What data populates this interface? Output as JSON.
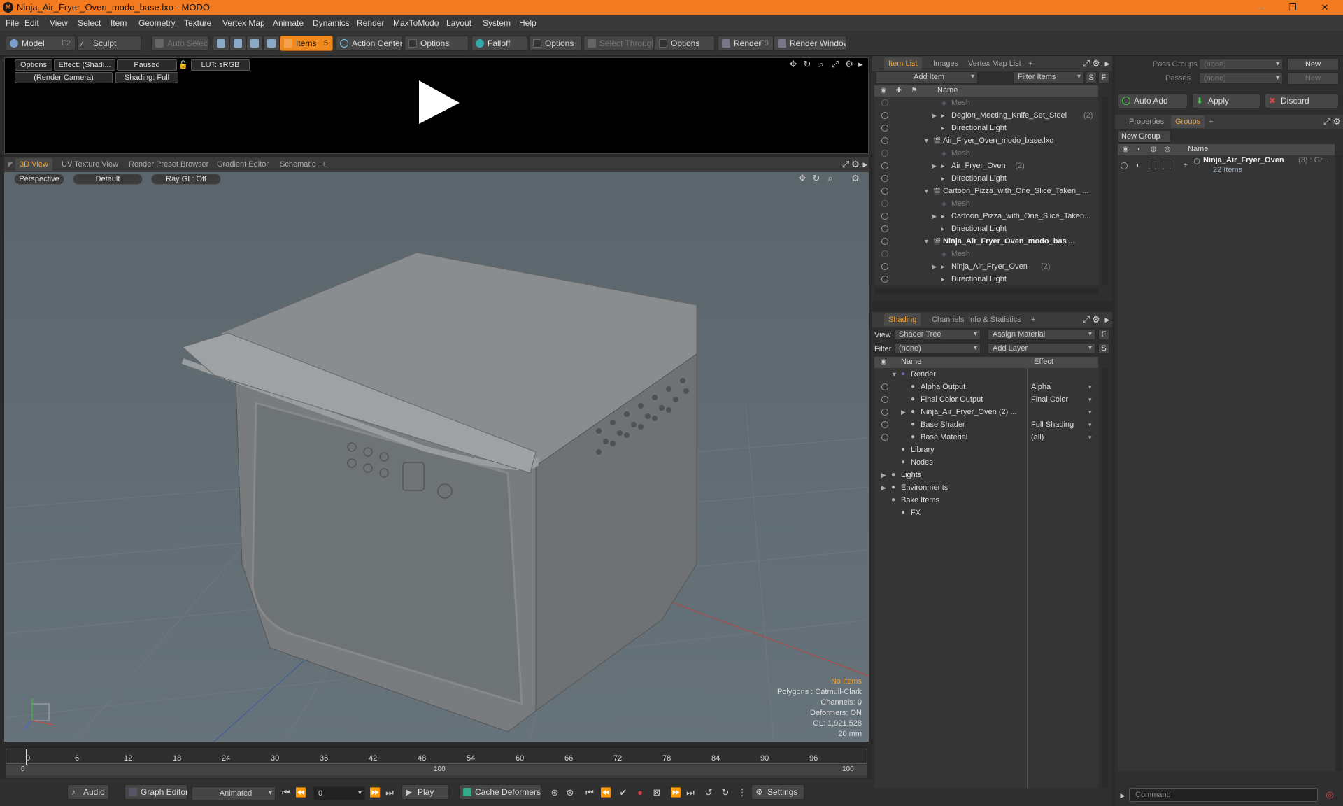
{
  "window": {
    "title": "Ninja_Air_Fryer_Oven_modo_base.lxo - MODO",
    "minimize": "–",
    "restore": "❐",
    "close": "✕"
  },
  "menu": [
    "File",
    "Edit",
    "View",
    "Select",
    "Item",
    "Geometry",
    "Texture",
    "Vertex Map",
    "Animate",
    "Dynamics",
    "Render",
    "MaxToModo",
    "Layout",
    "System",
    "Help"
  ],
  "toolbar": {
    "model": "Model",
    "model_key": "F2",
    "sculpt": "Sculpt",
    "auto_select": "Auto Select",
    "items": "Items",
    "items_key": "5",
    "action_center": "Action Center",
    "options1": "Options",
    "falloff": "Falloff",
    "options2": "Options",
    "select_through": "Select Through",
    "options3": "Options",
    "render": "Render",
    "render_key": "F9",
    "render_window": "Render Window"
  },
  "preview": {
    "options": "Options",
    "effect": "Effect: (Shadi...",
    "paused": "Paused",
    "lut": "LUT: sRGB",
    "camera": "(Render Camera)",
    "shading": "Shading: Full"
  },
  "viewport_tabs": [
    "3D View",
    "UV Texture View",
    "Render Preset Browser",
    "Gradient Editor",
    "Schematic",
    "+"
  ],
  "viewport": {
    "perspective": "Perspective",
    "default": "Default",
    "raygl": "Ray GL: Off"
  },
  "viewport_status": {
    "no_items": "No Items",
    "polygons": "Polygons : Catmull-Clark",
    "channels": "Channels: 0",
    "deformers": "Deformers: ON",
    "gl": "GL: 1,921,528",
    "scale": "20 mm"
  },
  "timeline": {
    "ticks": [
      "0",
      "6",
      "12",
      "18",
      "24",
      "30",
      "36",
      "42",
      "48",
      "54",
      "60",
      "66",
      "72",
      "78",
      "84",
      "90",
      "96"
    ],
    "start": "0",
    "mid": "100",
    "end": "100"
  },
  "bottombar": {
    "audio": "Audio",
    "graph_editor": "Graph Editor",
    "animated": "Animated",
    "frame": "0",
    "play": "Play",
    "cache_deformers": "Cache Deformers",
    "settings": "Settings"
  },
  "itemlist": {
    "tabs": [
      "Item List",
      "Images",
      "Vertex Map List",
      "+"
    ],
    "add_item": "Add Item",
    "filter_items": "Filter Items",
    "s": "S",
    "f": "F",
    "name_col": "Name",
    "rows": [
      {
        "label": "Mesh",
        "count": "",
        "indent": 2,
        "tri": "",
        "dim": true,
        "bold": false
      },
      {
        "label": "Deglon_Meeting_Knife_Set_Steel",
        "count": "(2)",
        "indent": 2,
        "tri": "▶",
        "dim": false,
        "bold": false
      },
      {
        "label": "Directional Light",
        "count": "",
        "indent": 2,
        "tri": "",
        "dim": false,
        "bold": false
      },
      {
        "label": "Air_Fryer_Oven_modo_base.lxo",
        "count": "",
        "indent": 1,
        "tri": "▼",
        "dim": false,
        "bold": false
      },
      {
        "label": "Mesh",
        "count": "",
        "indent": 2,
        "tri": "",
        "dim": true,
        "bold": false
      },
      {
        "label": "Air_Fryer_Oven",
        "count": "(2)",
        "indent": 2,
        "tri": "▶",
        "dim": false,
        "bold": false
      },
      {
        "label": "Directional Light",
        "count": "",
        "indent": 2,
        "tri": "",
        "dim": false,
        "bold": false
      },
      {
        "label": "Cartoon_Pizza_with_One_Slice_Taken_ ...",
        "count": "",
        "indent": 1,
        "tri": "▼",
        "dim": false,
        "bold": false
      },
      {
        "label": "Mesh",
        "count": "",
        "indent": 2,
        "tri": "",
        "dim": true,
        "bold": false
      },
      {
        "label": "Cartoon_Pizza_with_One_Slice_Taken...",
        "count": "",
        "indent": 2,
        "tri": "▶",
        "dim": false,
        "bold": false
      },
      {
        "label": "Directional Light",
        "count": "",
        "indent": 2,
        "tri": "",
        "dim": false,
        "bold": false
      },
      {
        "label": "Ninja_Air_Fryer_Oven_modo_bas ...",
        "count": "",
        "indent": 1,
        "tri": "▼",
        "dim": false,
        "bold": true
      },
      {
        "label": "Mesh",
        "count": "",
        "indent": 2,
        "tri": "",
        "dim": true,
        "bold": false
      },
      {
        "label": "Ninja_Air_Fryer_Oven",
        "count": "(2)",
        "indent": 2,
        "tri": "▶",
        "dim": false,
        "bold": false
      },
      {
        "label": "Directional Light",
        "count": "",
        "indent": 2,
        "tri": "",
        "dim": false,
        "bold": false
      }
    ]
  },
  "shading": {
    "tabs": [
      "Shading",
      "Channels",
      "Info & Statistics",
      "+"
    ],
    "view_label": "View",
    "view_value": "Shader Tree",
    "assign_material": "Assign Material",
    "filter_label": "Filter",
    "filter_value": "(none)",
    "add_layer": "Add Layer",
    "f": "F",
    "s": "S",
    "name_col": "Name",
    "effect_col": "Effect",
    "rows": [
      {
        "label": "Render",
        "effect": "",
        "eye": false,
        "indent": 0,
        "tri": "▼"
      },
      {
        "label": "Alpha Output",
        "effect": "Alpha",
        "eye": true,
        "indent": 1,
        "tri": ""
      },
      {
        "label": "Final Color Output",
        "effect": "Final Color",
        "eye": true,
        "indent": 1,
        "tri": ""
      },
      {
        "label": "Ninja_Air_Fryer_Oven (2) ...",
        "effect": "",
        "eye": true,
        "indent": 1,
        "tri": "▶"
      },
      {
        "label": "Base Shader",
        "effect": "Full Shading",
        "eye": true,
        "indent": 1,
        "tri": ""
      },
      {
        "label": "Base Material",
        "effect": "(all)",
        "eye": true,
        "indent": 1,
        "tri": ""
      },
      {
        "label": "Library",
        "effect": "",
        "eye": false,
        "indent": 0,
        "tri": ""
      },
      {
        "label": "Nodes",
        "effect": "",
        "eye": false,
        "indent": 0,
        "tri": ""
      },
      {
        "label": "Lights",
        "effect": "",
        "eye": false,
        "indent": -1,
        "tri": "▶"
      },
      {
        "label": "Environments",
        "effect": "",
        "eye": false,
        "indent": -1,
        "tri": "▶"
      },
      {
        "label": "Bake Items",
        "effect": "",
        "eye": false,
        "indent": -1,
        "tri": ""
      },
      {
        "label": "FX",
        "effect": "",
        "eye": false,
        "indent": 0,
        "tri": ""
      }
    ]
  },
  "right": {
    "pass_groups": "Pass Groups",
    "pass_groups_value": "(none)",
    "new1": "New",
    "passes": "Passes",
    "passes_value": "(none)",
    "new2": "New",
    "auto_add": "Auto Add",
    "apply": "Apply",
    "discard": "Discard",
    "tabs": [
      "Properties",
      "Groups",
      "+"
    ],
    "new_group": "New Group",
    "name_col": "Name",
    "group_name": "Ninja_Air_Fryer_Oven",
    "group_count": "(3) : Gr...",
    "group_items": "22 Items",
    "command": "Command"
  },
  "colors": {
    "accent": "#f47a20",
    "tab_active": "#f0a030"
  }
}
